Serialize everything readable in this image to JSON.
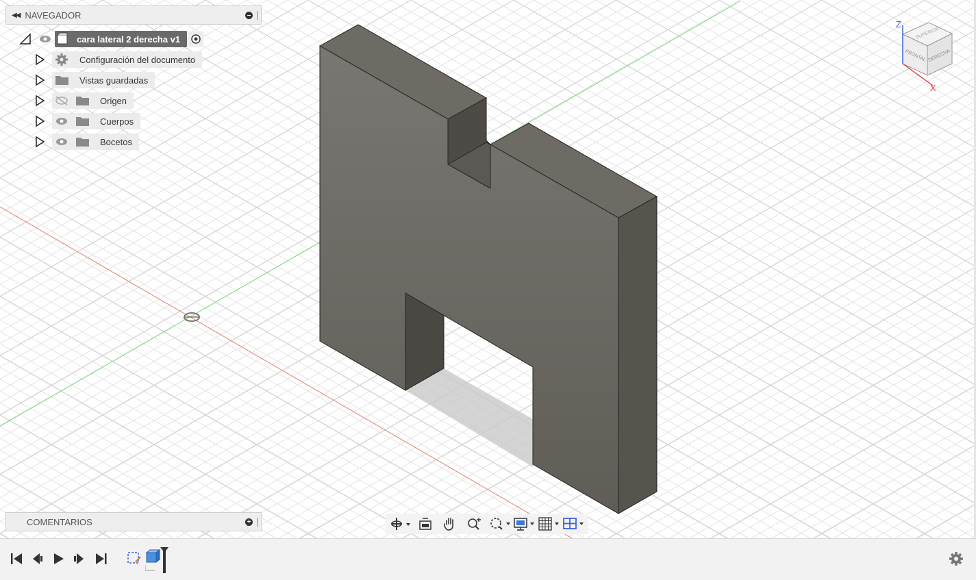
{
  "navigator": {
    "title": "NAVEGADOR",
    "root": "cara lateral 2 derecha v1",
    "items": [
      {
        "label": "Configuración del documento",
        "icon": "gear-icon",
        "visibility": "none"
      },
      {
        "label": "Vistas guardadas",
        "icon": "folder-icon",
        "visibility": "none"
      },
      {
        "label": "Origen",
        "icon": "folder-icon",
        "visibility": "hidden"
      },
      {
        "label": "Cuerpos",
        "icon": "folder-icon",
        "visibility": "visible"
      },
      {
        "label": "Bocetos",
        "icon": "folder-icon",
        "visibility": "visible"
      }
    ]
  },
  "comments": {
    "title": "COMENTARIOS"
  },
  "viewcube": {
    "top": "SUPERIOR",
    "front": "FRONTAL",
    "right": "DERECHA",
    "axis_z": "Z",
    "axis_x": "X"
  },
  "colors": {
    "axis_x": "#e06a5a",
    "axis_y": "#6ad06a",
    "body_front": "#75726c",
    "body_side": "#5a5650",
    "body_top": "#6e6a64",
    "accent": "#3b7ad9"
  },
  "toolbar": [
    "orbit-icon",
    "look-at-icon",
    "pan-icon",
    "zoom-icon",
    "fit-icon",
    "display-settings-icon",
    "grid-settings-icon",
    "viewports-icon"
  ],
  "timeline": [
    "first-icon",
    "prev-icon",
    "play-icon",
    "next-icon",
    "last-icon"
  ]
}
